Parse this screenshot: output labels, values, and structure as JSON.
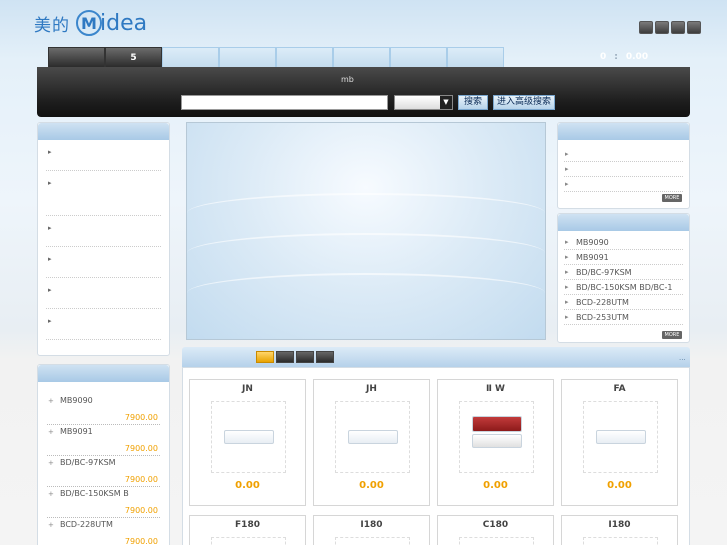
{
  "header": {
    "logo_cn": "美的",
    "logo_en": "idea",
    "logo_m": "M",
    "cart_count": "0",
    "cart_sep": ":",
    "cart_total": "0.00"
  },
  "nav": {
    "tabs": [
      "",
      "5",
      "",
      "",
      "",
      "",
      "",
      ""
    ]
  },
  "search": {
    "site_mark": "mb",
    "placeholder": "",
    "select_value": "",
    "search_label": "搜索",
    "advanced_label": "进入高级搜索"
  },
  "right_top": {
    "items": [
      "",
      "",
      ""
    ],
    "more": "MORE"
  },
  "right_bottom": {
    "items": [
      "MB9090",
      "MB9091",
      "BD/BC-97KSM",
      "BD/BC-150KSM BD/BC-1",
      "BCD-228UTM",
      "BCD-253UTM"
    ],
    "more": "MORE"
  },
  "left_lower": {
    "items": [
      {
        "name": "MB9090",
        "price": "7900.00"
      },
      {
        "name": "MB9091",
        "price": "7900.00"
      },
      {
        "name": "BD/BC-97KSM",
        "price": "7900.00"
      },
      {
        "name": "BD/BC-150KSM B",
        "price": "7900.00"
      },
      {
        "name": "BCD-228UTM",
        "price": "7900.00"
      }
    ]
  },
  "products": {
    "more": "...",
    "row1": [
      {
        "title": "JN",
        "price": "0.00"
      },
      {
        "title": "JH",
        "price": "0.00"
      },
      {
        "title": "Ⅱ   W",
        "price": "0.00"
      },
      {
        "title": "FA",
        "price": "0.00"
      }
    ],
    "row2": [
      {
        "title": "F180"
      },
      {
        "title": "I180"
      },
      {
        "title": "C180"
      },
      {
        "title": "I180"
      }
    ]
  },
  "colors": {
    "accent_blue": "#2f79c2",
    "price_orange": "#f0a000",
    "dark_bar": "#1d1d1d"
  }
}
